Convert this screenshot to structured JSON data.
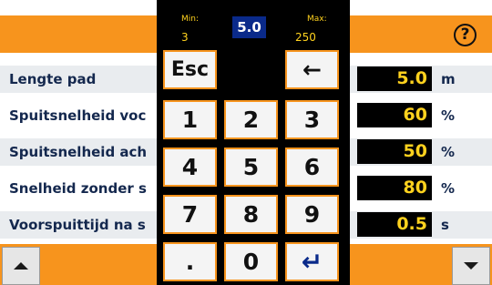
{
  "header": {
    "help_icon": "question-circle-icon"
  },
  "keypad": {
    "min_label": "Min:",
    "min_value": "3",
    "current_value": "5.0",
    "max_label": "Max:",
    "max_value": "250",
    "keys": [
      "Esc",
      "",
      "←",
      "1",
      "2",
      "3",
      "4",
      "5",
      "6",
      "7",
      "8",
      "9",
      ".",
      "0",
      "↵"
    ]
  },
  "settings": [
    {
      "label": "Lengte pad",
      "value": "5.0",
      "unit": "m"
    },
    {
      "label": "Spuitsnelheid voc",
      "value": "60",
      "unit": "%"
    },
    {
      "label": "Spuitsnelheid ach",
      "value": "50",
      "unit": "%"
    },
    {
      "label": "Snelheid zonder s",
      "value": "80",
      "unit": "%"
    },
    {
      "label": "Voorspuittijd na s",
      "value": "0.5",
      "unit": "s"
    }
  ],
  "colors": {
    "orange": "#f7941d",
    "value_text": "#ffd21e",
    "label_text": "#14284e"
  }
}
